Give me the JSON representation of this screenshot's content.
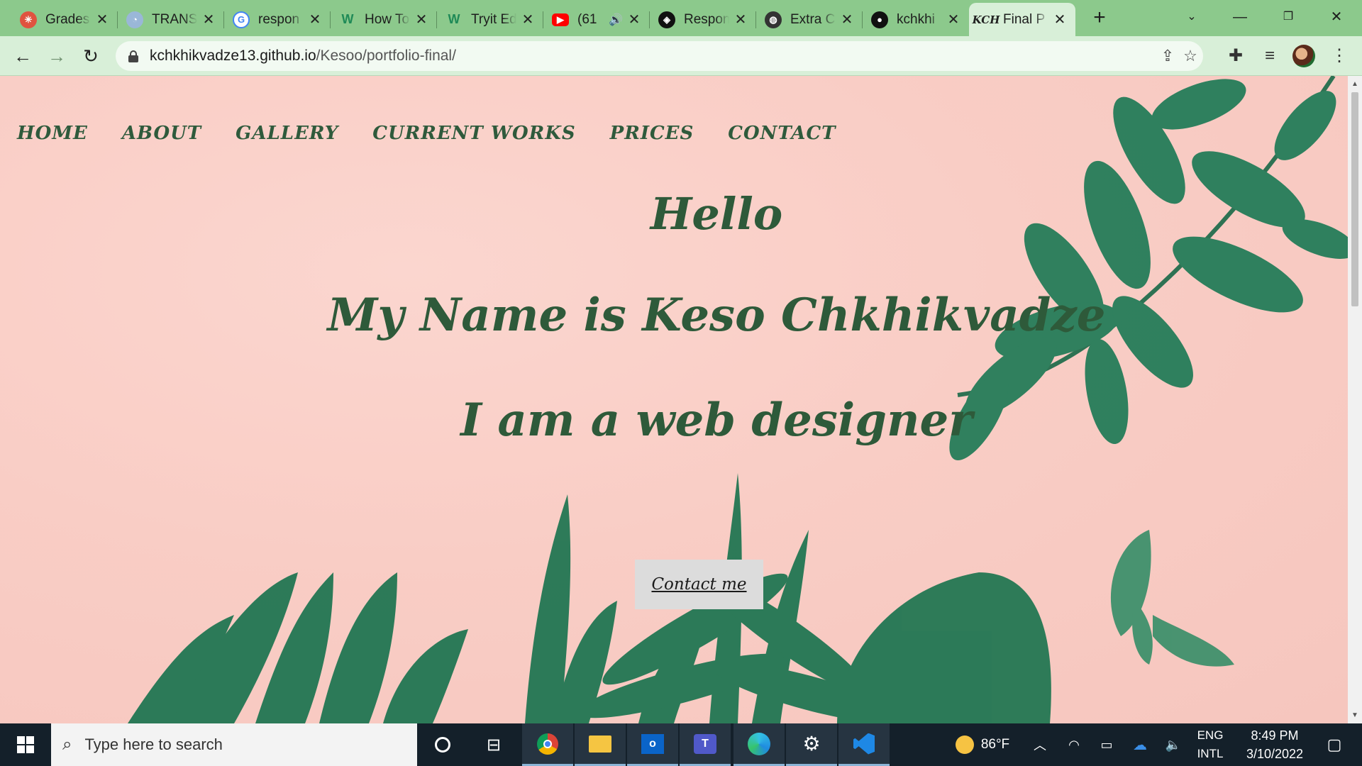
{
  "browser": {
    "tabs": [
      {
        "title": "Grades",
        "favicon": "grades-icon",
        "color": "#e0533f"
      },
      {
        "title": "TRANS",
        "favicon": "translate-icon",
        "color": "#9ab7d8"
      },
      {
        "title": "respon",
        "favicon": "google-icon",
        "color": "#4285f4"
      },
      {
        "title": "How To",
        "favicon": "w-icon",
        "color": "#2f9e6a"
      },
      {
        "title": "Tryit Ed",
        "favicon": "w-icon",
        "color": "#2f9e6a"
      },
      {
        "title": "(61",
        "favicon": "youtube-icon",
        "color": "#ff0000"
      },
      {
        "title": "Respon",
        "favicon": "codepen-icon",
        "color": "#111111"
      },
      {
        "title": "Extra C",
        "favicon": "globe-icon",
        "color": "#333333"
      },
      {
        "title": "kchkhi",
        "favicon": "github-icon",
        "color": "#111111"
      },
      {
        "title": "Final P",
        "favicon": "kch-icon",
        "color": "#333333"
      }
    ],
    "active_tab_index": 9,
    "url_host": "kchkhikvadze13.github.io",
    "url_path": "/Kesoo/portfolio-final/"
  },
  "page": {
    "menu": [
      "HOME",
      "ABOUT",
      "GALLERY",
      "CURRENT WORKS",
      "PRICES",
      "CONTACT"
    ],
    "hello": "Hello",
    "name_line": "My Name is Keso Chkhikvadze",
    "role_line": "I am a web designer",
    "contact_button": "Contact me",
    "text_color": "#2e5a3a",
    "background_color": "#f9cdc5"
  },
  "taskbar": {
    "search_placeholder": "Type here to search",
    "weather": "86°F",
    "lang_top": "ENG",
    "lang_bottom": "INTL",
    "time": "8:49 PM",
    "date": "3/10/2022"
  }
}
